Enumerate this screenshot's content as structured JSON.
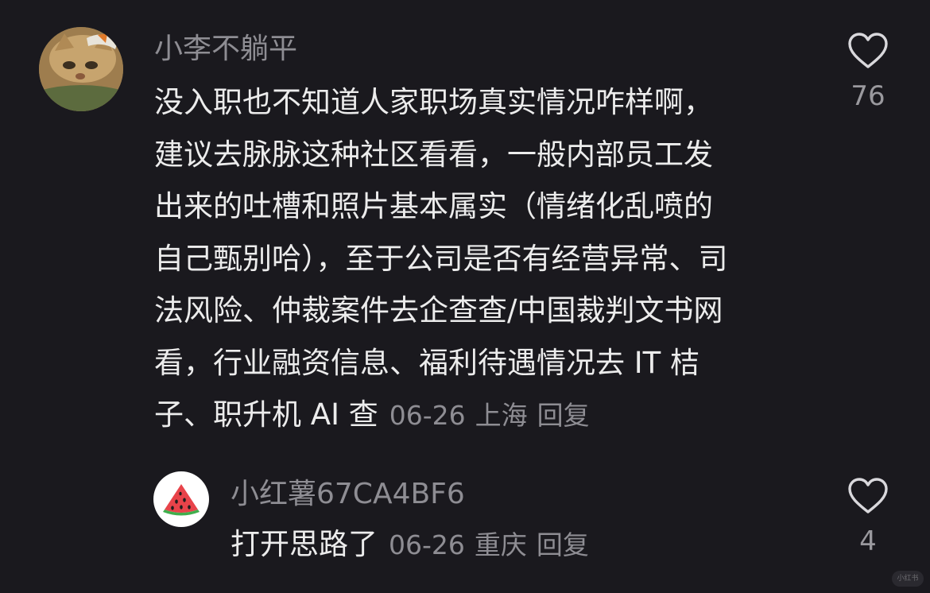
{
  "comments": [
    {
      "username": "小李不躺平",
      "avatar_icon": "cat-photo-avatar",
      "lines": [
        "没入职也不知道人家职场真实情况咋样啊，",
        "建议去脉脉这种社区看看，一般内部员工发",
        "出来的吐槽和照片基本属实（情绪化乱喷的",
        "自己甄别哈），至于公司是否有经营异常、司",
        "法风险、仲裁案件去企查查/中国裁判文书网",
        "看，行业融资信息、福利待遇情况去 IT 桔",
        "子、职升机 AI 查"
      ],
      "date": "06-26",
      "location": "上海",
      "reply_label": "回复",
      "like_icon": "heart-outline-icon",
      "like_count": "76"
    },
    {
      "username": "小红薯67CA4BF6",
      "avatar_icon": "watermelon-avatar",
      "lines": [
        "打开思路了"
      ],
      "date": "06-26",
      "location": "重庆",
      "reply_label": "回复",
      "like_icon": "heart-outline-icon",
      "like_count": "4"
    }
  ],
  "watermark": "小红书",
  "colors": {
    "background": "#1a191e",
    "text": "#ececec",
    "muted": "#8e8d93",
    "watermelon_red": "#e8434a",
    "watermelon_green": "#3fae4c"
  }
}
